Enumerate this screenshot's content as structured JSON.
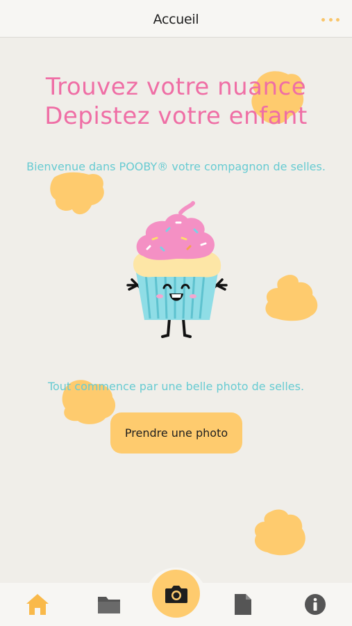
{
  "header": {
    "title": "Accueil",
    "more_icon": "more-dots-icon"
  },
  "hero": {
    "line1": "Trouvez votre nuance",
    "line2": "Depistez votre enfant"
  },
  "welcome_text": "Bienvenue dans POOBY® votre compagnon de selles.",
  "invite_text": "Tout commence par une belle photo de selles.",
  "photo_button_label": "Prendre une photo",
  "tabbar": {
    "items": [
      {
        "icon": "home-icon"
      },
      {
        "icon": "folder-icon"
      },
      {
        "icon": "camera-icon"
      },
      {
        "icon": "document-icon"
      },
      {
        "icon": "info-icon"
      }
    ]
  },
  "colors": {
    "accent": "#fecb6e",
    "headline": "#ef6ea5",
    "text_teal": "#67cbd2",
    "background": "#f0eee9",
    "active_tab": "#f9b94a",
    "inactive_tab": "#555555"
  }
}
